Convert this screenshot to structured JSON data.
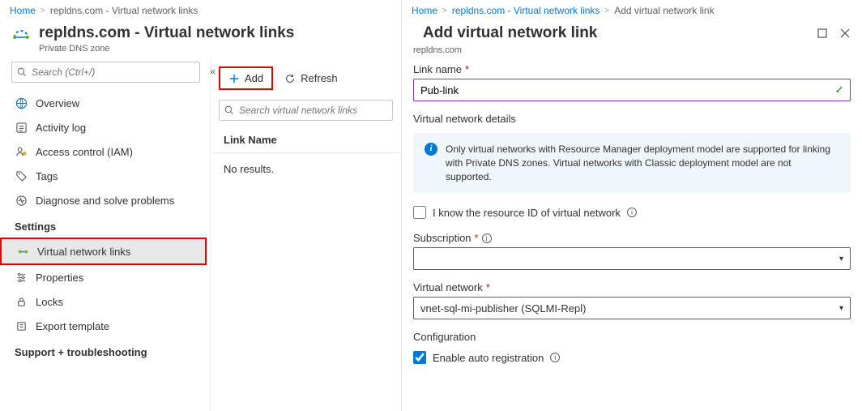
{
  "left": {
    "breadcrumb": {
      "home": "Home",
      "resource": "repldns.com - Virtual network links"
    },
    "title": "repldns.com - Virtual network links",
    "subtitle": "Private DNS zone",
    "sidebar": {
      "search_placeholder": "Search (Ctrl+/)",
      "items": [
        {
          "label": "Overview"
        },
        {
          "label": "Activity log"
        },
        {
          "label": "Access control (IAM)"
        },
        {
          "label": "Tags"
        },
        {
          "label": "Diagnose and solve problems"
        }
      ],
      "settings_header": "Settings",
      "settings_items": [
        {
          "label": "Virtual network links"
        },
        {
          "label": "Properties"
        },
        {
          "label": "Locks"
        },
        {
          "label": "Export template"
        }
      ],
      "support_header": "Support + troubleshooting"
    },
    "toolbar": {
      "add": "Add",
      "refresh": "Refresh"
    },
    "filter_placeholder": "Search virtual network links",
    "table": {
      "col_link_name": "Link Name",
      "no_results": "No results."
    }
  },
  "right": {
    "breadcrumb": {
      "home": "Home",
      "resource": "repldns.com - Virtual network links",
      "current": "Add virtual network link"
    },
    "title": "Add virtual network link",
    "subtitle": "repldns.com",
    "form": {
      "link_name_label": "Link name",
      "link_name_value": "Pub-link",
      "vnet_details_header": "Virtual network details",
      "infobox_text": "Only virtual networks with Resource Manager deployment model are supported for linking with Private DNS zones. Virtual networks with Classic deployment model are not supported.",
      "know_resource_id_label": "I know the resource ID of virtual network",
      "know_resource_id_checked": false,
      "subscription_label": "Subscription",
      "subscription_value": "",
      "vnet_label": "Virtual network",
      "vnet_value": "vnet-sql-mi-publisher (SQLMI-Repl)",
      "configuration_header": "Configuration",
      "auto_reg_label": "Enable auto registration",
      "auto_reg_checked": true
    }
  }
}
